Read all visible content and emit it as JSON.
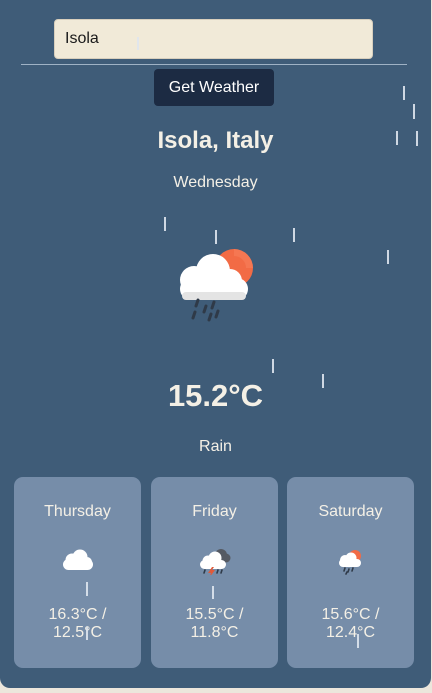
{
  "search": {
    "value": "Isola",
    "button_label": "Get Weather"
  },
  "current": {
    "location": "Isola, Italy",
    "day": "Wednesday",
    "temperature": "15.2°C",
    "condition": "Rain",
    "icon": "rain-cloud-sun-icon"
  },
  "forecast": [
    {
      "day": "Thursday",
      "temp_line1": "16.3°C /",
      "temp_line2": "12.5°C",
      "icon": "cloud-icon"
    },
    {
      "day": "Friday",
      "temp_line1": "15.5°C /",
      "temp_line2": "11.8°C",
      "icon": "thunderstorm-icon"
    },
    {
      "day": "Saturday",
      "temp_line1": "15.6°C /",
      "temp_line2": "12.4°C",
      "icon": "rain-cloud-sun-icon"
    }
  ],
  "colors": {
    "background": "#3f5c78",
    "card": "#768da9",
    "button": "#1c2b43",
    "input": "#f1ead8",
    "sun": "#f26b45",
    "text": "#f4f0e6"
  }
}
